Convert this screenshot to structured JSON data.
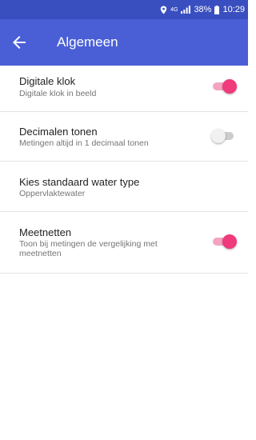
{
  "status_bar": {
    "battery_percent": "38%",
    "time": "10:29",
    "network_label": "4G"
  },
  "app_bar": {
    "title": "Algemeen"
  },
  "settings": [
    {
      "title": "Digitale klok",
      "description": "Digitale klok in beeld",
      "toggle": true
    },
    {
      "title": "Decimalen tonen",
      "description": "Metingen altijd in 1 decimaal tonen",
      "toggle": false
    },
    {
      "title": "Kies standaard water type",
      "description": "Oppervlaktewater"
    },
    {
      "title": "Meetnetten",
      "description": "Toon bij metingen de vergelijking met meetnetten",
      "toggle": true
    }
  ],
  "colors": {
    "status_bar": "#3a4fbf",
    "app_bar": "#4a5fd6",
    "accent": "#ef3a7c"
  }
}
